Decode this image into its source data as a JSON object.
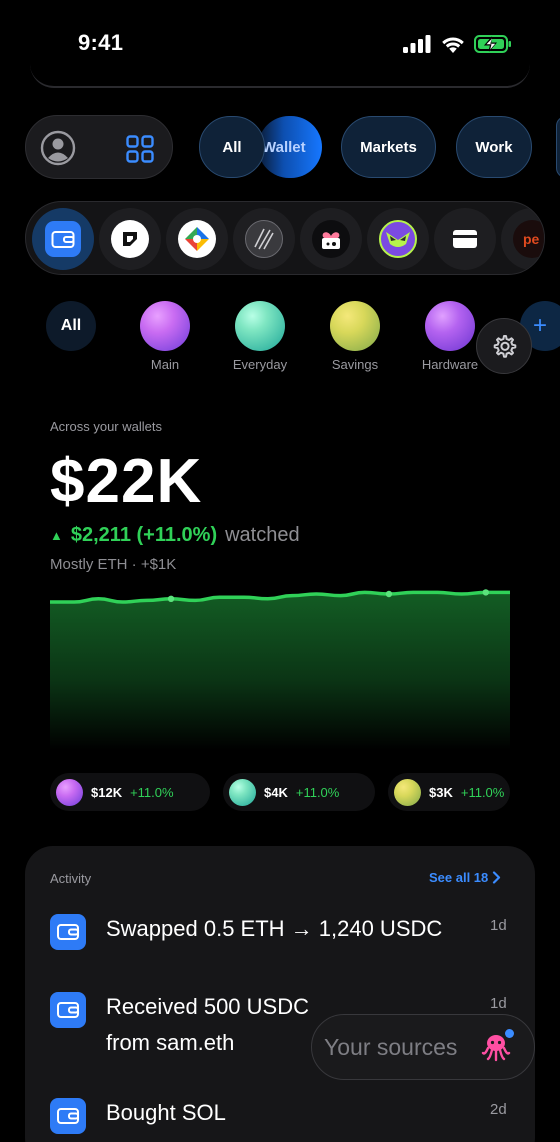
{
  "status_bar": {
    "time": "9:41"
  },
  "filters": {
    "chips": [
      {
        "label": "All"
      },
      {
        "label": "Wallet"
      },
      {
        "label": "Markets"
      },
      {
        "label": "Work"
      }
    ]
  },
  "apps": {
    "items": [
      {
        "icon": "wallet-app-icon",
        "color": "#2e7bf6"
      },
      {
        "icon": "brand-app-icon"
      },
      {
        "icon": "colorful-app-icon"
      },
      {
        "icon": "stripes-app-icon"
      },
      {
        "icon": "heart-wallet-app-icon"
      },
      {
        "icon": "owl-app-icon"
      },
      {
        "icon": "card-app-icon"
      },
      {
        "icon": "partial-app-icon",
        "label": "pe"
      }
    ]
  },
  "groups": {
    "all_label": "All",
    "items": [
      {
        "label": "Main",
        "color_a": "#c96cf2",
        "color_b": "#6b3bd9"
      },
      {
        "label": "Everyday",
        "color_a": "#7fe6c2",
        "color_b": "#1ba597"
      },
      {
        "label": "Savings",
        "color_a": "#d8d85a",
        "color_b": "#8fb24c"
      },
      {
        "label": "Hardware",
        "color_a": "#b463f0",
        "color_b": "#6a34d0"
      }
    ],
    "plus_label": "+"
  },
  "balance": {
    "caption": "Across your wallets",
    "amount": "$22K",
    "change_value": "$2,211 (+11.0%)",
    "change_suffix": "watched",
    "subtitle": "Mostly ETH · +$1K"
  },
  "chart_data": {
    "type": "area",
    "series": [
      {
        "values": [
          22.0,
          22.0,
          22.2,
          22.0,
          22.1,
          22.2,
          22.1,
          22.3,
          22.3,
          22.2,
          22.4,
          22.5,
          22.4,
          22.6,
          22.5,
          22.6,
          22.6,
          22.5,
          22.6,
          22.6
        ]
      }
    ],
    "markers": [
      5,
      14,
      18
    ],
    "ylim": [
      0,
      24
    ],
    "grid": false,
    "color": "#30d158"
  },
  "breakdown": [
    {
      "amount": "$12K",
      "pct": "+11.0%",
      "color_a": "#c96cf2",
      "color_b": "#6b3bd9"
    },
    {
      "amount": "$4K",
      "pct": "+11.0%",
      "color_a": "#7fe6c2",
      "color_b": "#1ba597"
    },
    {
      "amount": "$3K",
      "pct": "+11.0%",
      "color_a": "#d8d85a",
      "color_b": "#8fb24c"
    }
  ],
  "activity": {
    "title": "Activity",
    "see_all": "See all 18",
    "items": [
      {
        "line1": "Swapped 0.5 ETH → 1,240 USDC",
        "line2": "",
        "time": "1d"
      },
      {
        "line1": "Received 500 USDC",
        "line2": "from sam.eth",
        "time": "1d"
      },
      {
        "line1": "Bought SOL",
        "line2": "",
        "time": "2d"
      }
    ]
  },
  "sources": {
    "label": "Your sources"
  }
}
